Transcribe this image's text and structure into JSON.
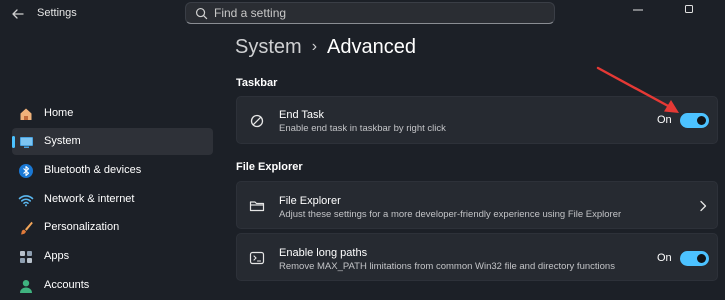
{
  "window": {
    "title": "Settings",
    "search_placeholder": "Find a setting"
  },
  "breadcrumb": {
    "parent": "System",
    "separator": "›",
    "current": "Advanced"
  },
  "sidebar": {
    "items": [
      {
        "label": "Home",
        "icon": "home-icon"
      },
      {
        "label": "System",
        "icon": "system-monitor-icon",
        "selected": true
      },
      {
        "label": "Bluetooth & devices",
        "icon": "bluetooth-icon"
      },
      {
        "label": "Network & internet",
        "icon": "wifi-icon"
      },
      {
        "label": "Personalization",
        "icon": "paintbrush-icon"
      },
      {
        "label": "Apps",
        "icon": "apps-icon"
      },
      {
        "label": "Accounts",
        "icon": "account-icon"
      }
    ]
  },
  "sections": {
    "taskbar": {
      "title": "Taskbar",
      "end_task": {
        "title": "End Task",
        "subtitle": "Enable end task in taskbar by right click",
        "state": "On",
        "enabled": true
      }
    },
    "file_explorer": {
      "title": "File Explorer",
      "file_explorer": {
        "title": "File Explorer",
        "subtitle": "Adjust these settings for a more developer-friendly experience using File Explorer"
      },
      "long_paths": {
        "title": "Enable long paths",
        "subtitle": "Remove MAX_PATH limitations from common Win32 file and directory functions",
        "state": "On",
        "enabled": true
      }
    }
  },
  "colors": {
    "accent": "#4cc2ff",
    "annotation_arrow": "#e53935",
    "background": "#1c2027",
    "card": "#262a31"
  }
}
